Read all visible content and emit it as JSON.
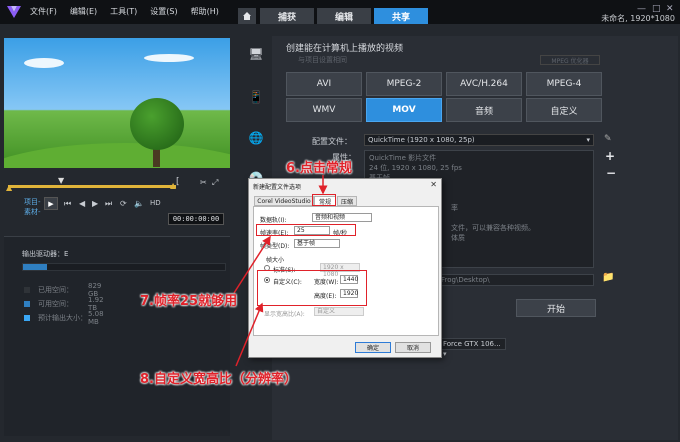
{
  "menu": [
    "文件(F)",
    "编辑(E)",
    "工具(T)",
    "设置(S)",
    "帮助(H)"
  ],
  "tabs": [
    {
      "label": "捕获"
    },
    {
      "label": "编辑"
    },
    {
      "label": "共享",
      "active": true
    }
  ],
  "project_name": "未命名, 1920*1080",
  "preview": {
    "project_label": "项目-",
    "clip_label": "素材-",
    "hd_label": "HD",
    "timecode": "00:00:00:00"
  },
  "output": {
    "drive_label": "输出驱动器：E",
    "drive_fill_fraction": 0.12,
    "legend": [
      {
        "label": "已用空间：",
        "value": "829 GB",
        "color": "#2f3338"
      },
      {
        "label": "可用空间：",
        "value": "1.92 TB",
        "color": "#2f7fc1"
      },
      {
        "label": "预计输出大小：",
        "value": "5.08 MB",
        "color": "#3aa7f5"
      }
    ]
  },
  "share": {
    "title": "创建能在计算机上播放的视频",
    "subtitle": "与项目设置相同",
    "mpeg_option": "MPEG 优化器",
    "formats": [
      {
        "label": "AVI"
      },
      {
        "label": "MPEG-2"
      },
      {
        "label": "AVC/H.264"
      },
      {
        "label": "MPEG-4"
      },
      {
        "label": "WMV"
      },
      {
        "label": "MOV",
        "active": true
      },
      {
        "label": "音频"
      },
      {
        "label": "自定义"
      }
    ],
    "config_label": "配置文件：",
    "config_value": "QuickTime (1920 x 1080, 25p)",
    "props_label": "属性：",
    "props_lines": [
      "QuickTime 影片文件",
      "24 位, 1920 x 1080, 25 fps",
      "基于帧",
      "",
      "",
      "率",
      "",
      "文件，可以兼容各种视频。",
      "体质"
    ],
    "path_value": "\\Muse Frog\\Desktop\\",
    "start_label": "开始",
    "gpu_value": "Force GTX 106..."
  },
  "dialog": {
    "title": "新建配置文件选项",
    "tabs": [
      "Corel VideoStudio",
      "常规",
      "压缩"
    ],
    "data_track_label": "数据轨(I):",
    "data_track_value": "音频和视频",
    "frame_rate_label": "帧速率(E):",
    "frame_rate_value": "25",
    "frame_rate_unit": "帧/秒",
    "frame_type_label": "帧类型(D):",
    "frame_type_value": "基于帧",
    "frame_size_label": "帧大小",
    "standard_label": "标准(S):",
    "standard_value": "1920 x 1080",
    "custom_label": "自定义(C):",
    "width_label": "宽度(W):",
    "width_value": "1440",
    "height_label": "高度(E):",
    "height_value": "1920",
    "aspect_label": "显示宽高比(A):",
    "aspect_value": "自定义",
    "ok_label": "确定",
    "cancel_label": "取消"
  },
  "annotations": {
    "step6": "6.点击常规",
    "step7": "7.帧率25就够用",
    "step8": "8.自定义宽高比（分辨率）"
  }
}
